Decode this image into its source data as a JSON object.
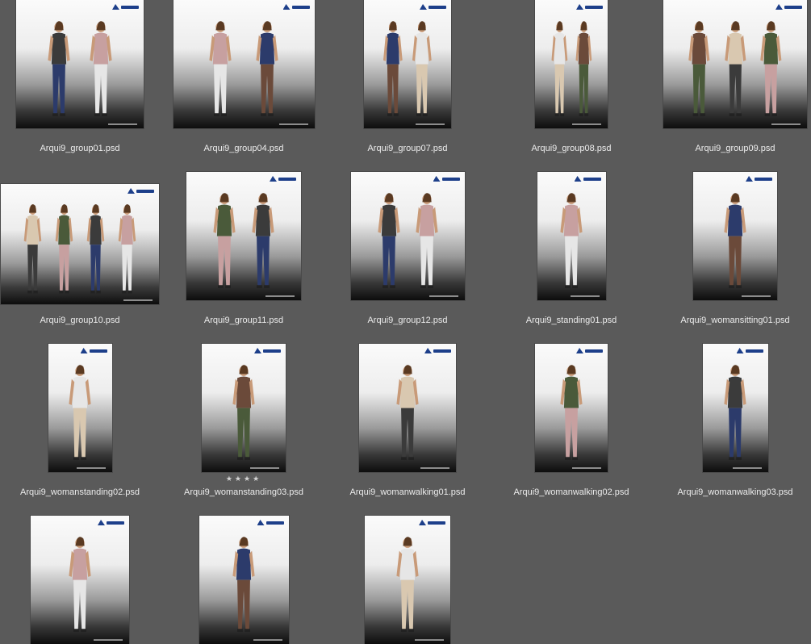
{
  "app": {
    "view": "thumbnail-grid"
  },
  "brand": {
    "logo_text": "ARQUI 9"
  },
  "colors": {
    "background": "#5a5a5a",
    "caption": "#ececec",
    "logo": "#1d3f8a"
  },
  "files": [
    {
      "name": "Arqui9_group01.psd",
      "people": 2
    },
    {
      "name": "Arqui9_group04.psd",
      "people": 2
    },
    {
      "name": "Arqui9_group07.psd",
      "people": 2
    },
    {
      "name": "Arqui9_group08.psd",
      "people": 2
    },
    {
      "name": "Arqui9_group09.psd",
      "people": 3
    },
    {
      "name": "Arqui9_group10.psd",
      "people": 4
    },
    {
      "name": "Arqui9_group11.psd",
      "people": 2
    },
    {
      "name": "Arqui9_group12.psd",
      "people": 2
    },
    {
      "name": "Arqui9_standing01.psd",
      "people": 1
    },
    {
      "name": "Arqui9_womansitting01.psd",
      "people": 1
    },
    {
      "name": "Arqui9_womanstanding02.psd",
      "people": 1
    },
    {
      "name": "Arqui9_womanstanding03.psd",
      "people": 1,
      "rating": "★★★★"
    },
    {
      "name": "Arqui9_womanwalking01.psd",
      "people": 1
    },
    {
      "name": "Arqui9_womanwalking02.psd",
      "people": 1
    },
    {
      "name": "Arqui9_womanwalking03.psd",
      "people": 1
    },
    {
      "name": "",
      "people": 1
    },
    {
      "name": "",
      "people": 1
    },
    {
      "name": "",
      "people": 1
    }
  ]
}
